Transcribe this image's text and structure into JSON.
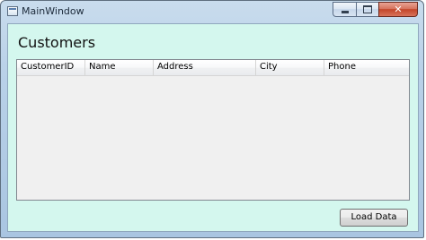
{
  "window": {
    "title": "MainWindow",
    "caption_buttons": {
      "close_glyph": "✕"
    }
  },
  "main": {
    "heading": "Customers",
    "grid": {
      "columns": [
        "CustomerID",
        "Name",
        "Address",
        "City",
        "Phone"
      ],
      "rows": []
    },
    "load_button_label": "Load Data"
  },
  "colors": {
    "client_background": "#d4f7ee",
    "grid_background": "#f0f0f0",
    "close_button": "#c34529"
  }
}
